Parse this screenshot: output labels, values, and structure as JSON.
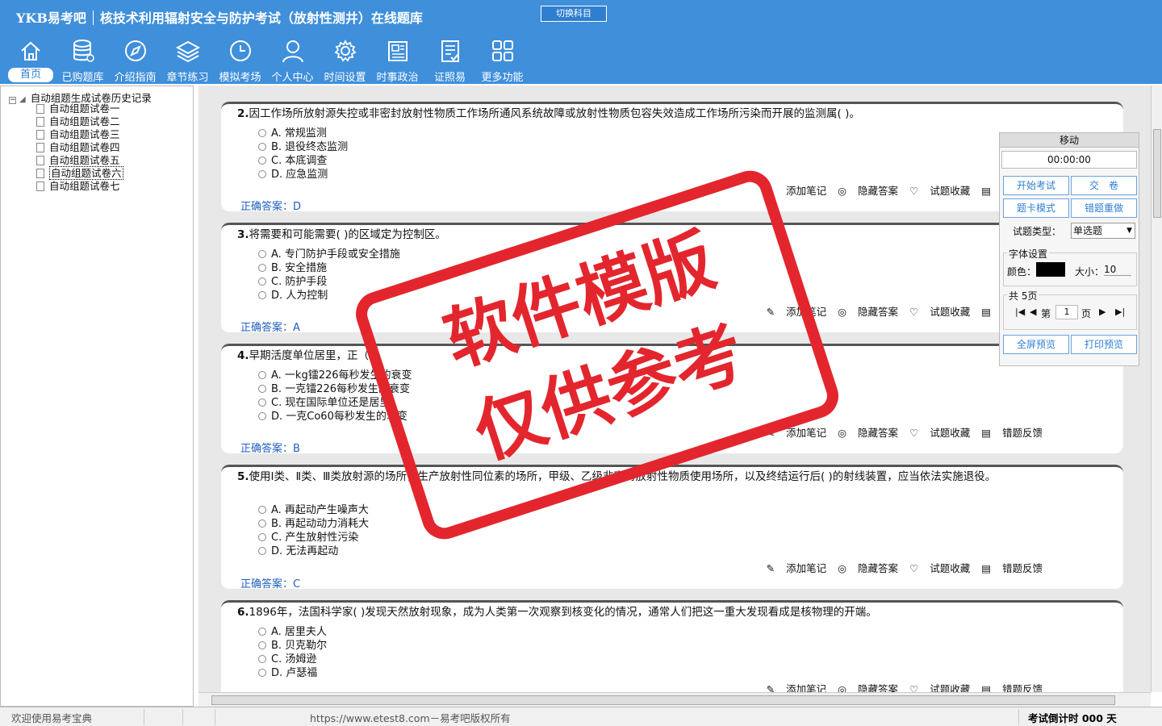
{
  "header": {
    "brand_logo": "YKB易考吧",
    "title": "核技术利用辐射安全与防护考试（放射性测井）在线题库",
    "switch_label": "切换科目"
  },
  "nav": [
    {
      "label": "首页",
      "icon": "home-icon"
    },
    {
      "label": "已购题库",
      "icon": "database-icon"
    },
    {
      "label": "介绍指南",
      "icon": "compass-icon"
    },
    {
      "label": "章节练习",
      "icon": "layers-icon"
    },
    {
      "label": "模拟考场",
      "icon": "clock-icon"
    },
    {
      "label": "个人中心",
      "icon": "user-icon"
    },
    {
      "label": "时间设置",
      "icon": "gear-icon"
    },
    {
      "label": "时事政治",
      "icon": "newspaper-icon"
    },
    {
      "label": "证照易",
      "icon": "checklist-icon"
    },
    {
      "label": "更多功能",
      "icon": "grid-icon"
    }
  ],
  "tree": {
    "root": "自动组题生成试卷历史记录",
    "items": [
      "自动组题试卷一",
      "自动组题试卷二",
      "自动组题试卷三",
      "自动组题试卷四",
      "自动组题试卷五",
      "自动组题试卷六",
      "自动组题试卷七"
    ]
  },
  "tools": {
    "note": "添加笔记",
    "hide": "隐藏答案",
    "fav": "试题收藏",
    "report": "错题反馈"
  },
  "questions": [
    {
      "num": "2.",
      "text": "因工作场所放射源失控或非密封放射性物质工作场所通风系统故障或放射性物质包容失效造成工作场所污染而开展的监测属( )。",
      "options": [
        "A. 常规监测",
        "B. 退役终态监测",
        "C. 本底调查",
        "D. 应急监测"
      ],
      "answer_label": "正确答案：",
      "answer": "D"
    },
    {
      "num": "3.",
      "text": "将需要和可能需要( )的区域定为控制区。",
      "options": [
        "A. 专门防护手段或安全措施",
        "B. 安全措施",
        "C. 防护手段",
        "D. 人为控制"
      ],
      "answer_label": "正确答案：",
      "answer": "A"
    },
    {
      "num": "4.",
      "text": "早期活度单位居里，正（ ）",
      "options": [
        "A. 一kg镭226每秒发生的衰变",
        "B. 一克镭226每秒发生的衰变",
        "C. 现在国际单位还是居里",
        "D. 一克Co60每秒发生的衰变"
      ],
      "answer_label": "正确答案：",
      "answer": "B"
    },
    {
      "num": "5.",
      "text": "使用Ⅰ类、Ⅱ类、Ⅲ类放射源的场所，生产放射性同位素的场所，甲级、乙级非密封放射性物质使用场所，以及终结运行后( )的射线装置，应当依法实施退役。",
      "options": [
        "A. 再起动产生噪声大",
        "B. 再起动动力消耗大",
        "C. 产生放射性污染",
        "D. 无法再起动"
      ],
      "answer_label": "正确答案：",
      "answer": "C"
    },
    {
      "num": "6.",
      "text": "1896年，法国科学家( )发现天然放射现象，成为人类第一次观察到核变化的情况，通常人们把这一重大发现看成是核物理的开端。",
      "options": [
        "A. 居里夫人",
        "B. 贝克勒尔",
        "C. 汤姆逊",
        "D. 卢瑟福"
      ],
      "answer_label": "",
      "answer": ""
    }
  ],
  "panel": {
    "title": "移动",
    "timer": "00:00:00",
    "start": "开始考试",
    "submit": "交　卷",
    "card_mode": "题卡模式",
    "redo": "错题重做",
    "type_label": "试题类型：",
    "type_value": "单选题",
    "font_group": "字体设置",
    "color_label": "颜色：",
    "color_value": "#000000",
    "size_label": "大小：",
    "size_value": "10",
    "pages_label": "共 5页",
    "page_prefix": "第",
    "page_value": "1",
    "page_suffix": "页",
    "fullscreen": "全屏预览",
    "print": "打印预览"
  },
  "stamp": {
    "line1": "软件模版",
    "line2": "仅供参考",
    "color": "#e3262e"
  },
  "status": {
    "welcome": "欢迎使用易考宝典",
    "copyright": "https://www.etest8.com－易考吧版权所有",
    "countdown": "考试倒计时 000 天"
  }
}
